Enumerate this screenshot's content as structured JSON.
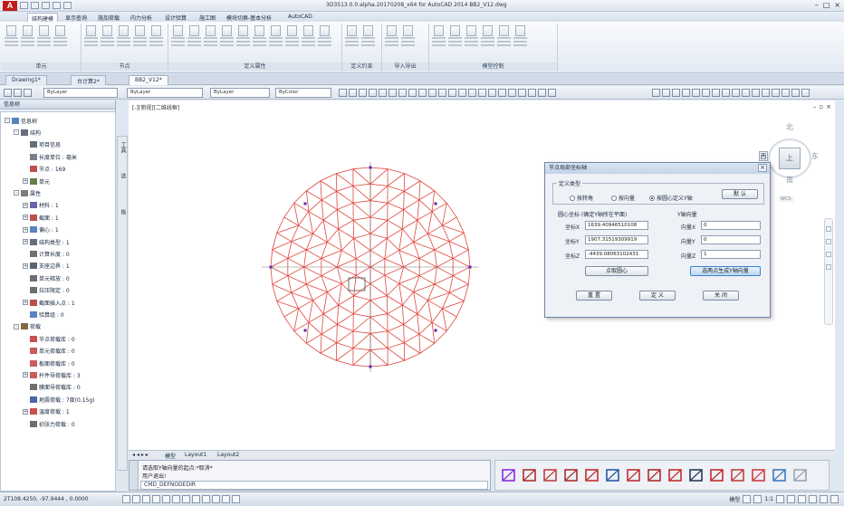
{
  "window": {
    "title": "3D3513.0.0.alpha.20170208_x64 for AutoCAD 2014    BB2_V12.dwg"
  },
  "ribbon": {
    "tabs": [
      "结构建模",
      "显示查询",
      "施加荷载",
      "内力分析",
      "设计验算",
      "施工图",
      "模块切换-基本分析",
      "AutoCAD"
    ],
    "groups": [
      "单元",
      "节点",
      "定义属性",
      "定义约束",
      "导入导出",
      "模型控制"
    ]
  },
  "doc_tabs": [
    "Drawing1*",
    "台计算2*",
    "BB2_V12*"
  ],
  "properties_bar": {
    "layer": "ByLayer",
    "linetype": "ByLayer",
    "lineweight": "ByLayer",
    "color": "ByColor"
  },
  "left_panel": {
    "title": "信息树",
    "tree": [
      {
        "text": "信息树",
        "level": 0,
        "exp": "-",
        "icon": "doc"
      },
      {
        "text": "结构",
        "level": 1,
        "exp": "-",
        "icon": "grid"
      },
      {
        "text": "项目信息",
        "level": 2,
        "exp": "",
        "icon": "grid"
      },
      {
        "text": "长度单位 : 毫米",
        "level": 2,
        "exp": "",
        "icon": "ruler"
      },
      {
        "text": "节点 : 169",
        "level": 2,
        "exp": "",
        "icon": "node"
      },
      {
        "text": "单元",
        "level": 2,
        "exp": "+",
        "icon": "elem"
      },
      {
        "text": "属性",
        "level": 1,
        "exp": "-",
        "icon": "attr"
      },
      {
        "text": "材料 : 1",
        "level": 2,
        "exp": "+",
        "icon": "mat"
      },
      {
        "text": "截面 : 1",
        "level": 2,
        "exp": "+",
        "icon": "sec"
      },
      {
        "text": "偏心 : 1",
        "level": 2,
        "exp": "+",
        "icon": "ecc"
      },
      {
        "text": "结构类型 : 1",
        "level": 2,
        "exp": "+",
        "icon": "grid"
      },
      {
        "text": "计算长度 : 0",
        "level": 2,
        "exp": "",
        "icon": "len"
      },
      {
        "text": "支座边界 : 1",
        "level": 2,
        "exp": "+",
        "icon": "sup"
      },
      {
        "text": "单元释放 : 0",
        "level": 2,
        "exp": "",
        "icon": "len"
      },
      {
        "text": "拉压限定 : 0",
        "level": 2,
        "exp": "",
        "icon": "len"
      },
      {
        "text": "截面插入点 : 1",
        "level": 2,
        "exp": "+",
        "icon": "sec"
      },
      {
        "text": "验算组 : 0",
        "level": 2,
        "exp": "",
        "icon": "doc"
      },
      {
        "text": "荷载",
        "level": 1,
        "exp": "-",
        "icon": "load"
      },
      {
        "text": "节点荷载库 : 0",
        "level": 2,
        "exp": "",
        "icon": "arrow"
      },
      {
        "text": "单元荷载库 : 0",
        "level": 2,
        "exp": "",
        "icon": "bars"
      },
      {
        "text": "板面荷载库 : 0",
        "level": 2,
        "exp": "",
        "icon": "bars"
      },
      {
        "text": "杆件导荷载库 : 3",
        "level": 2,
        "exp": "+",
        "icon": "bars"
      },
      {
        "text": "膜面导荷载库 : 0",
        "level": 2,
        "exp": "",
        "icon": "len"
      },
      {
        "text": "地震荷载 : 7度(0.15g)",
        "level": 2,
        "exp": "",
        "icon": "wave"
      },
      {
        "text": "温度荷载 : 1",
        "level": 2,
        "exp": "+",
        "icon": "temp"
      },
      {
        "text": "初张力荷载 : 0",
        "level": 2,
        "exp": "",
        "icon": "len"
      }
    ],
    "side_tabs": [
      "工具",
      "选",
      "板"
    ]
  },
  "viewport": {
    "label": "[-][俯视][二维线框]",
    "viewcube": {
      "north": "北",
      "east": "东",
      "south": "南",
      "west": "西",
      "top": "上",
      "wcs": "WCS"
    }
  },
  "dialog": {
    "title": "节点局部坐标轴",
    "close": "×",
    "group_type": "定义类型",
    "radio_rotation": "按转角",
    "radio_vector": "按向量",
    "radio_circle": "按圆心定义Y轴",
    "default_btn": "默 认",
    "center_title": "圆心坐标 (确定Y轴所在平面)",
    "axis_title": "Y轴向量",
    "coord_x_label": "坐标X",
    "coord_y_label": "坐标Y",
    "coord_z_label": "坐标Z",
    "coord_x": "1639.40946510108",
    "coord_y": "1907.31519309919",
    "coord_z": "-4439.08063102431",
    "vec_x_label": "向量X",
    "vec_y_label": "向量Y",
    "vec_z_label": "向量Z",
    "vec_x": "0",
    "vec_y": "0",
    "vec_z": "1",
    "pick_center_btn": "点取圆心",
    "pick_axis_btn": "选两点生成Y轴向量",
    "reset_btn": "重 置",
    "define_btn": "定 义",
    "close_btn": "关 闭"
  },
  "layout_tabs": [
    "模型",
    "Layout1",
    "Layout2"
  ],
  "command": {
    "line1": "请选取Y轴向量的起点:*取消*",
    "line2": "用户退出!",
    "input": "CMD_DEFNODEDIR"
  },
  "statusbar": {
    "coords": "2T108.4250, -97.9444 , 0.0000",
    "model": "模型",
    "scale": "1:1"
  }
}
